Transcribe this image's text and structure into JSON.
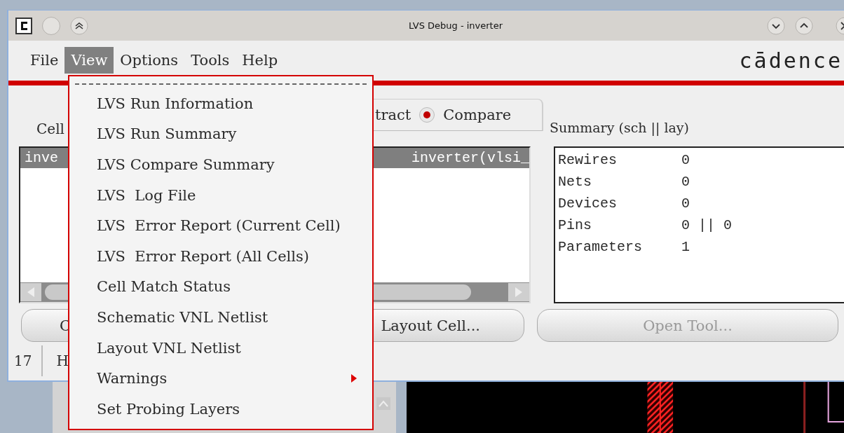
{
  "window": {
    "title": "LVS Debug - inverter"
  },
  "menu_bar": [
    {
      "label": "File",
      "selected": false
    },
    {
      "label": "View",
      "selected": true
    },
    {
      "label": "Options",
      "selected": false
    },
    {
      "label": "Tools",
      "selected": false
    },
    {
      "label": "Help",
      "selected": false
    }
  ],
  "logo": "cādence",
  "cell_label": "Cell",
  "extract_label": "tract",
  "compare_option": {
    "label": "Compare",
    "selected": true
  },
  "cell_list": {
    "rows": [
      {
        "schematic": "inve",
        "layout": "inverter(vlsi_",
        "selected": true
      }
    ]
  },
  "summary": {
    "title": "Summary (sch || lay)",
    "rows": [
      {
        "name": "Rewires",
        "value": "0"
      },
      {
        "name": "Nets",
        "value": "0"
      },
      {
        "name": "Devices",
        "value": "0"
      },
      {
        "name": "Pins",
        "value": "0 || 0"
      },
      {
        "name": "Parameters",
        "value": "1"
      }
    ]
  },
  "buttons": [
    {
      "label": "C",
      "disabled": false
    },
    {
      "label": "Layout Cell...",
      "disabled": false
    },
    {
      "label": "Open Tool...",
      "disabled": true
    }
  ],
  "status_bar": [
    "17",
    "H"
  ],
  "view_menu": {
    "items": [
      {
        "label": "LVS Run Information",
        "submenu": false
      },
      {
        "label": "LVS Run Summary",
        "submenu": false
      },
      {
        "label": "LVS Compare Summary",
        "submenu": false
      },
      {
        "label": "LVS  Log File",
        "submenu": false
      },
      {
        "label": "LVS  Error Report (Current Cell)",
        "submenu": false
      },
      {
        "label": "LVS  Error Report (All Cells)",
        "submenu": false
      },
      {
        "label": "Cell Match Status",
        "submenu": false
      },
      {
        "label": "Schematic VNL Netlist",
        "submenu": false
      },
      {
        "label": "Layout VNL Netlist",
        "submenu": false
      },
      {
        "label": "Warnings",
        "submenu": true
      },
      {
        "label": "Set Probing Layers",
        "submenu": false
      }
    ]
  }
}
